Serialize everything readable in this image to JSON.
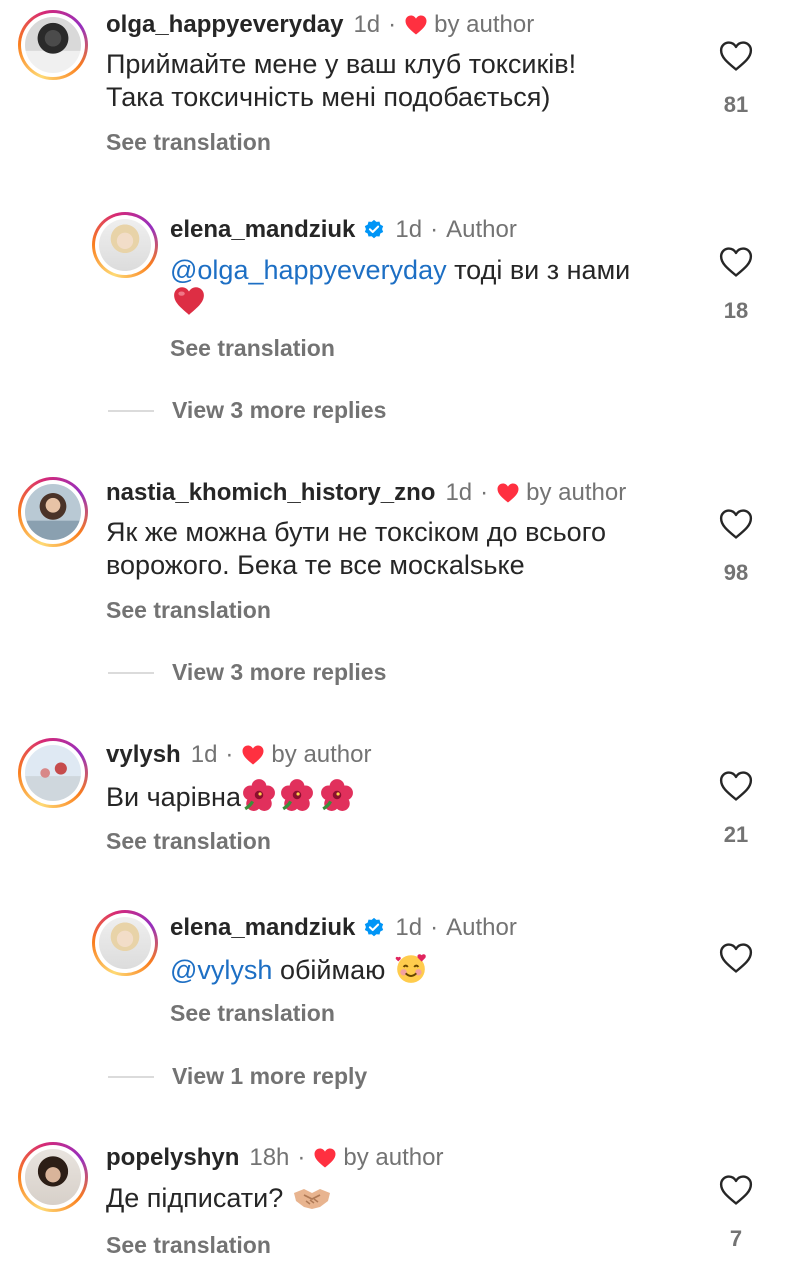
{
  "comments": [
    {
      "username": "olga_happyeveryday",
      "time": "1d",
      "by_author": "by author",
      "text_line1": "Приймайте мене у ваш клуб токсиків!",
      "text_line2": "Така токсичність мені подобається)",
      "see_translation": "See translation",
      "likes": "81"
    },
    {
      "username": "elena_mandziuk",
      "time": "1d",
      "author_tag": "Author",
      "mention": "@olga_happyeveryday",
      "text_rest": " тоді ви з нами",
      "emoji": "red-heart",
      "see_translation": "See translation",
      "likes": "18",
      "view_replies": "View 3 more replies"
    },
    {
      "username": "nastia_khomich_history_zno",
      "time": "1d",
      "by_author": "by author",
      "text_line1": "Як же можна бути не токсіком до всього",
      "text_line2": "ворожого. Бека те все москаlsьке",
      "see_translation": "See translation",
      "likes": "98",
      "view_replies": "View 3 more replies"
    },
    {
      "username": "vylysh",
      "time": "1d",
      "by_author": "by author",
      "text": "Ви чарівна",
      "emoji": "hibiscus x3",
      "see_translation": "See translation",
      "likes": "21"
    },
    {
      "username": "elena_mandziuk",
      "time": "1d",
      "author_tag": "Author",
      "mention": "@vylysh",
      "text_rest": " обіймаю ",
      "emoji": "smiling-face-with-hearts",
      "see_translation": "See translation",
      "view_replies": "View 1 more reply"
    },
    {
      "username": "popelyshyn",
      "time": "18h",
      "by_author": "by author",
      "text": "Де підписати? ",
      "emoji": "handshake",
      "see_translation": "See translation",
      "likes": "7"
    }
  ],
  "separator": "·",
  "colors": {
    "like_red": "#ff3040",
    "verified_blue": "#0095f6",
    "muted": "#737373",
    "mention": "#1d6fc4"
  }
}
